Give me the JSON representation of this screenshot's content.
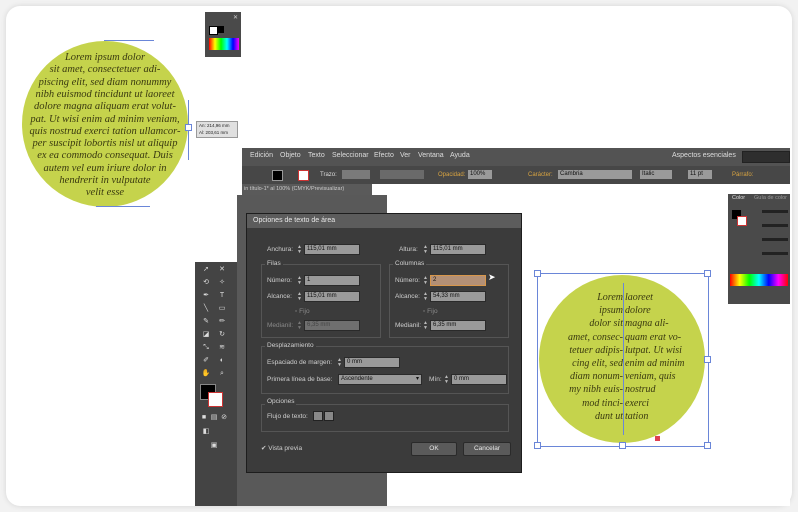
{
  "left_circle": {
    "lines": [
      "Lorem ipsum dolor",
      "sit amet, consectetuer adi-",
      "piscing elit, sed diam nonummy",
      "nibh euismod tincidunt ut laoreet",
      "dolore magna aliquam erat volut-",
      "pat. Ut wisi enim ad minim veniam,",
      "quis nostrud exerci tation ullamcor-",
      "per suscipit lobortis nisl ut aliquip",
      "ex ea commodo consequat. Duis",
      "autem vel eum iriure dolor in",
      "hendrerit in vulputate",
      "velit esse"
    ],
    "size_tooltip": [
      "An: 214,96 mm",
      "Al: 203,61 mm"
    ]
  },
  "menubar": {
    "items": [
      "Edición",
      "Objeto",
      "Texto",
      "Seleccionar",
      "Efecto",
      "Ver",
      "Ventana",
      "Ayuda"
    ],
    "workspace": "Aspectos esenciales"
  },
  "controlbar": {
    "trazo": "Trazo:",
    "opacidad_label": "Opacidad:",
    "opacidad_value": "100%",
    "caracter_label": "Carácter:",
    "font": "Cambria",
    "style": "Italic",
    "size": "11 pt",
    "parrafo": "Párrafo:"
  },
  "doc_tab": "in título-1* al 100% (CMYK/Previsualizar)",
  "dialog": {
    "title": "Opciones de texto de área",
    "anchura_label": "Anchura:",
    "anchura_value": "115,01 mm",
    "altura_label": "Altura:",
    "altura_value": "115,01 mm",
    "filas": {
      "heading": "Filas",
      "numero_label": "Número:",
      "numero_value": "1",
      "alcance_label": "Alcance:",
      "alcance_value": "115,01 mm",
      "fijo": "Fijo",
      "medianil_label": "Medianil:",
      "medianil_value": "6,35 mm"
    },
    "columnas": {
      "heading": "Columnas",
      "numero_label": "Número:",
      "numero_value": "2",
      "alcance_label": "Alcance:",
      "alcance_value": "54,33 mm",
      "fijo": "Fijo",
      "medianil_label": "Medianil:",
      "medianil_value": "6,35 mm"
    },
    "desplazamiento": {
      "heading": "Desplazamiento",
      "espaciado_label": "Espaciado de margen:",
      "espaciado_value": "0 mm",
      "primera_label": "Primera línea de base:",
      "primera_value": "Ascendente",
      "min_label": "Mín:",
      "min_value": "0 mm"
    },
    "opciones": {
      "heading": "Opciones",
      "flujo_label": "Flujo de texto:"
    },
    "vista_previa": "Vista previa",
    "ok": "OK",
    "cancelar": "Cancelar"
  },
  "right_circle": {
    "col1": [
      "Lorem",
      "ipsum",
      "dolor sit",
      "amet, consec-",
      "tetuer adipis-",
      "cing elit, sed",
      "diam nonum-",
      "my nibh euis-",
      "mod tinci-",
      "dunt ut"
    ],
    "col2": [
      "laoreet",
      "dolore",
      "magna ali-",
      "quam erat vo-",
      "lutpat. Ut wisi",
      "enim ad minim",
      "veniam, quis",
      "nostrud",
      "exerci",
      "tation"
    ]
  },
  "color_panel": {
    "tab1": "Color",
    "tab2": "Guía de color"
  },
  "colors": {
    "circle_fill": "#c5d34c",
    "ui_dark": "#3c3c3c",
    "selection": "#6a86d8"
  }
}
